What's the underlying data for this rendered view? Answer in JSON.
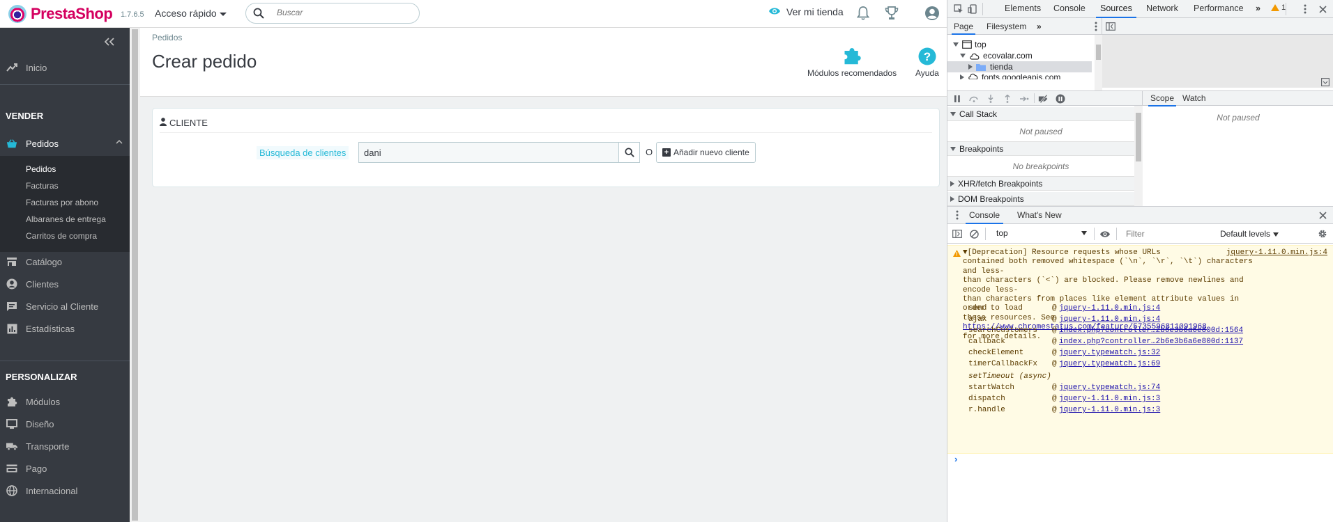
{
  "header": {
    "logo_text_a": "Presta",
    "logo_text_b": "Shop",
    "version": "1.7.6.5",
    "quick_access": "Acceso rápido",
    "search_placeholder": "Buscar",
    "view_shop": "Ver mi tienda"
  },
  "sidebar": {
    "inicio": "Inicio",
    "section_sell": "VENDER",
    "pedidos": "Pedidos",
    "sub_items": [
      "Pedidos",
      "Facturas",
      "Facturas por abono",
      "Albaranes de entrega",
      "Carritos de compra"
    ],
    "catalogo": "Catálogo",
    "clientes": "Clientes",
    "servicio": "Servicio al Cliente",
    "estadisticas": "Estadísticas",
    "section_custom": "PERSONALIZAR",
    "modulos": "Módulos",
    "diseno": "Diseño",
    "transporte": "Transporte",
    "pago": "Pago",
    "internacional": "Internacional"
  },
  "page": {
    "breadcrumb": "Pedidos",
    "title": "Crear pedido",
    "toolbar_modules": "Módulos recomendados",
    "toolbar_help": "Ayuda"
  },
  "customer_panel": {
    "heading": "Cliente",
    "search_label": "Búsqueda de clientes",
    "search_value": "dani",
    "or_text": "O",
    "add_button": "Añadir nuevo cliente"
  },
  "devtools": {
    "tabs": [
      "Elements",
      "Console",
      "Sources",
      "Network",
      "Performance"
    ],
    "more": "»",
    "warn_count": "1",
    "sources_nav_tabs": [
      "Page",
      "Filesystem"
    ],
    "nav_more": "»",
    "tree": [
      "top",
      "ecovalar.com",
      "tienda",
      "fonts.googleapis.com"
    ],
    "sections": {
      "call_stack": "Call Stack",
      "call_stack_body": "Not paused",
      "breakpoints": "Breakpoints",
      "breakpoints_body": "No breakpoints",
      "xhr": "XHR/fetch Breakpoints",
      "dom": "DOM Breakpoints"
    },
    "scope_tabs": [
      "Scope",
      "Watch"
    ],
    "scope_body": "Not paused",
    "drawer_tabs": [
      "Console",
      "What's New"
    ],
    "context": "top",
    "filter_placeholder": "Filter",
    "levels": "Default levels",
    "warning": {
      "text_a": "▼[Deprecation] Resource requests whose URLs\ncontained both removed whitespace (`\\n`, `\\r`, `\\t`) characters and less-\nthan characters (`<`) are blocked. Please remove newlines and encode less-\nthan characters from places like element attribute values in order to load\nthese resources. See ",
      "link": "https://www.chromestatus.com/feature/5735596811091968",
      "text_b": "\nfor more details.",
      "source": "jquery-1.11.0.min.js:4"
    },
    "stack": [
      {
        "fn": "send",
        "src": "jquery-1.11.0.min.js:4"
      },
      {
        "fn": "ajax",
        "src": "jquery-1.11.0.min.js:4"
      },
      {
        "fn": "searchCustomers",
        "src": "index.php?controller…2b6e3b6a6e800d:1564"
      },
      {
        "fn": "callback",
        "src": "index.php?controller…2b6e3b6a6e800d:1137"
      },
      {
        "fn": "checkElement",
        "src": "jquery.typewatch.js:32"
      },
      {
        "fn": "timerCallbackFx",
        "src": "jquery.typewatch.js:69"
      }
    ],
    "async_label": "setTimeout (async)",
    "stack2": [
      {
        "fn": "startWatch",
        "src": "jquery.typewatch.js:74"
      },
      {
        "fn": "dispatch",
        "src": "jquery-1.11.0.min.js:3"
      },
      {
        "fn": "r.handle",
        "src": "jquery-1.11.0.min.js:3"
      }
    ],
    "prompt": "›"
  }
}
